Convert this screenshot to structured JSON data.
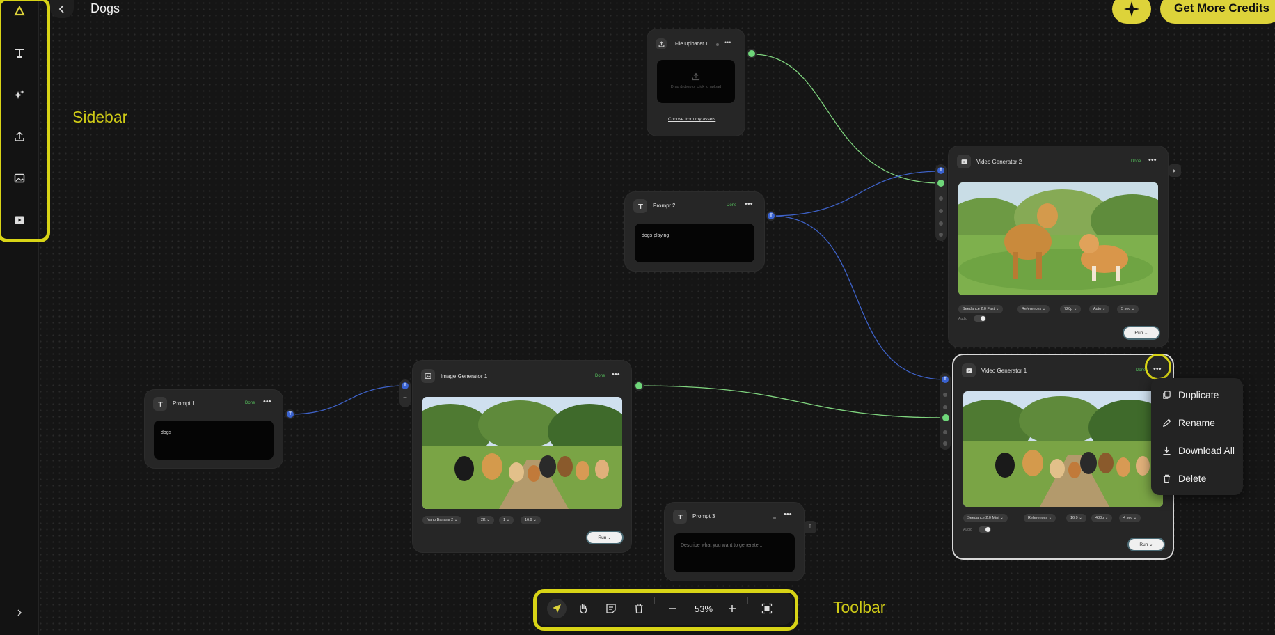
{
  "page": {
    "title": "Dogs"
  },
  "sidebar": {
    "logo_icon": "brand-logo-icon",
    "items": [
      {
        "icon": "text-icon"
      },
      {
        "icon": "sparkles-icon"
      },
      {
        "icon": "upload-icon"
      },
      {
        "icon": "image-icon"
      },
      {
        "icon": "video-icon"
      }
    ],
    "expand_icon": "chevron-right-icon"
  },
  "header": {
    "credits_label": "Get More Credits",
    "accent": "#ddd33a"
  },
  "annotations": {
    "sidebar": "Sidebar",
    "toolbar": "Toolbar",
    "color": "#d8d416"
  },
  "nodes": {
    "file_uploader": {
      "title": "File Uploader 1",
      "dropzone_text": "Drag & drop or click to upload",
      "assets_link": "Choose from my assets"
    },
    "prompt2": {
      "title": "Prompt 2",
      "status": "Done",
      "text": "dogs playing"
    },
    "prompt1": {
      "title": "Prompt 1",
      "status": "Done",
      "text": "dogs"
    },
    "prompt3": {
      "title": "Prompt 3",
      "placeholder": "Describe what you want to generate..."
    },
    "image_gen1": {
      "title": "Image Generator 1",
      "status": "Done",
      "model": "Nano Banana 2",
      "resolution": "2K",
      "count": "1",
      "ratio": "16:9",
      "run_label": "Run"
    },
    "video_gen2": {
      "title": "Video Generator 2",
      "status": "Done",
      "model": "Seedance 2.0 Fast",
      "mode": "References",
      "quality": "720p",
      "ratio": "Auto",
      "duration": "5 sec",
      "audio_label": "Audio",
      "run_label": "Run"
    },
    "video_gen1": {
      "title": "Video Generator 1",
      "status": "Done",
      "model": "Seedance 2.0 Mini",
      "mode": "References",
      "ratio": "16:9",
      "quality": "480p",
      "duration": "4 sec",
      "audio_label": "Audio",
      "run_label": "Run"
    }
  },
  "port_labels": {
    "text": "T"
  },
  "context_menu": {
    "items": [
      {
        "label": "Duplicate",
        "icon": "duplicate-icon"
      },
      {
        "label": "Rename",
        "icon": "pencil-icon"
      },
      {
        "label": "Download All",
        "icon": "download-icon"
      },
      {
        "label": "Delete",
        "icon": "trash-icon"
      }
    ]
  },
  "toolbar": {
    "zoom": "53%",
    "tools": [
      "select-tool-icon",
      "hand-tool-icon",
      "sticky-note-icon",
      "trash-icon",
      "zoom-out-icon",
      "zoom-in-icon",
      "fit-view-icon"
    ]
  },
  "colors": {
    "text_port": "#3a63d1",
    "image_port": "#6fd67a",
    "done": "#56c25d"
  }
}
